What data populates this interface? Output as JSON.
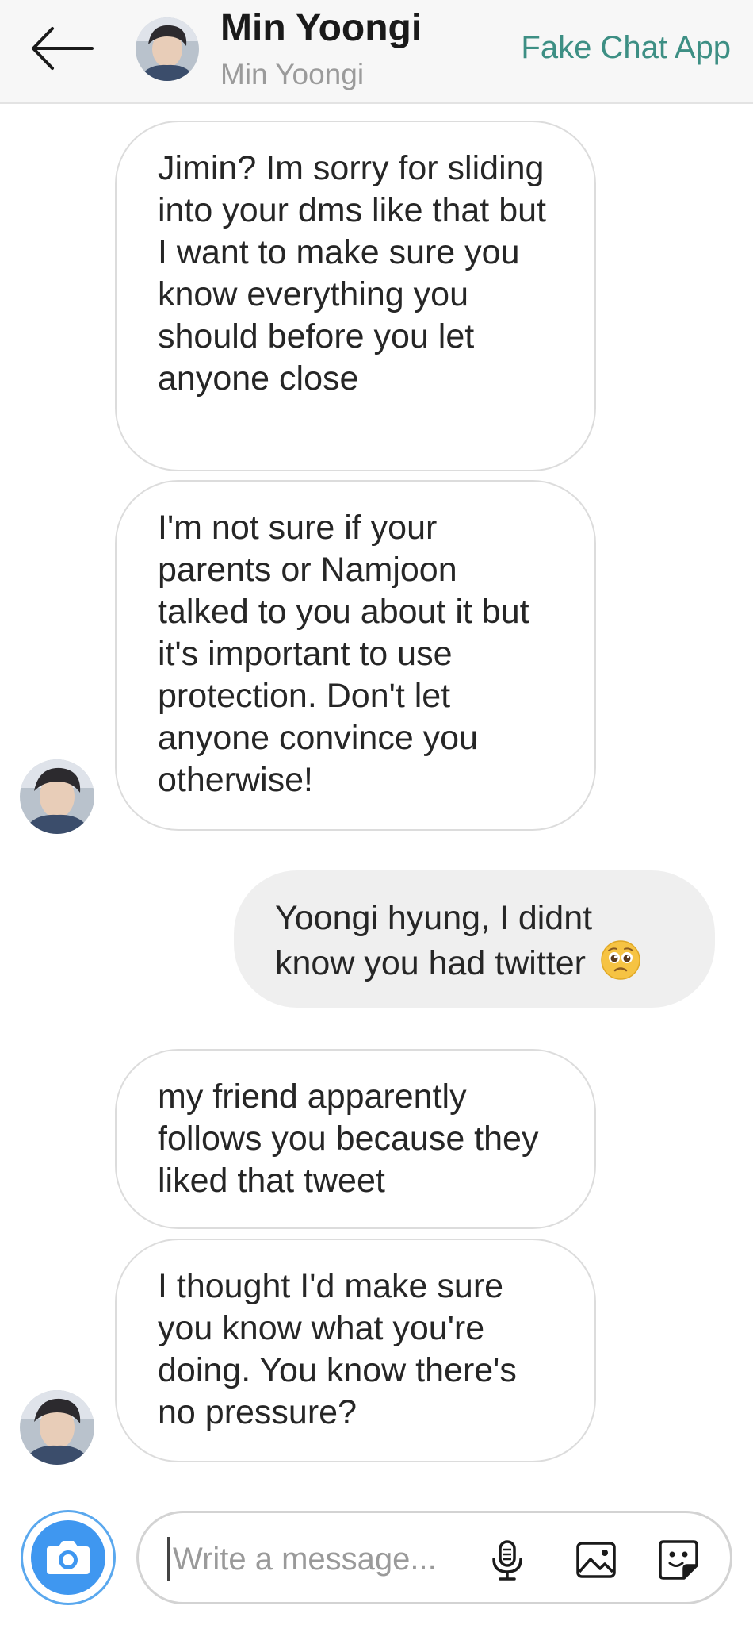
{
  "header": {
    "title": "Min Yoongi",
    "subtitle": "Min Yoongi",
    "brand": "Fake Chat App"
  },
  "messages": [
    {
      "side": "in",
      "text": "Jimin? Im sorry for sliding into your dms like that but I want to make sure you know everything you should before you let anyone close"
    },
    {
      "side": "in",
      "text": "I'm not sure if your parents or Namjoon talked to you about it but it's important to use protection. Don't let anyone convince you otherwise!"
    },
    {
      "side": "out",
      "text": "Yoongi hyung, I didnt know you had twitter",
      "emoji": "pleading-face"
    },
    {
      "side": "in",
      "text": "my friend apparently follows you because they liked that tweet"
    },
    {
      "side": "in",
      "text": "I thought I'd make sure you know what you're doing. You know there's no pressure?"
    }
  ],
  "composer": {
    "placeholder": "Write a message...",
    "icons": [
      "camera-icon",
      "microphone-icon",
      "image-icon",
      "sticker-icon"
    ]
  },
  "colors": {
    "accent": "#3d8f84",
    "camera": "#3f97f0",
    "outgoing_bubble": "#efefef",
    "header_bg": "#f7f7f7"
  }
}
